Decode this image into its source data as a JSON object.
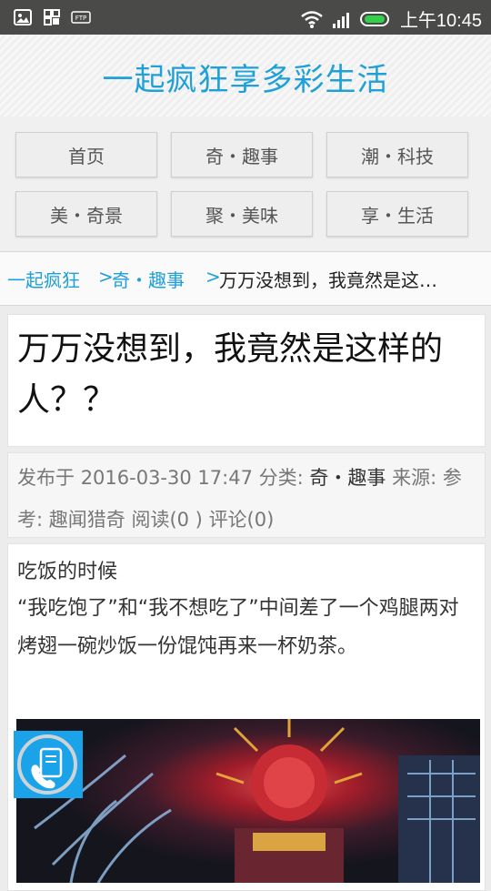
{
  "status_bar": {
    "time": "上午10:45",
    "icons": [
      "image-icon",
      "grid-icon",
      "ftp-icon",
      "wifi-icon",
      "signal-icon",
      "battery-icon"
    ]
  },
  "header": {
    "title": "一起疯狂享多彩生活"
  },
  "nav": {
    "items": [
      {
        "label": "首页"
      },
      {
        "label": "奇・趣事"
      },
      {
        "label": "潮・科技"
      },
      {
        "label": "美・奇景"
      },
      {
        "label": "聚・美味"
      },
      {
        "label": "享・生活"
      }
    ]
  },
  "breadcrumb": {
    "home": "一起疯狂",
    "category": "奇・趣事",
    "current": "万万没想到，我竟然是这…",
    "separator": ">"
  },
  "post": {
    "title": "万万没想到，我竟然是这样的人？？",
    "meta": {
      "published_prefix": "发布于",
      "date": "2016-03-30 17:47",
      "category_prefix": "分类:",
      "category": "奇・趣事",
      "source_prefix": "来源:",
      "source": "参考:",
      "source_name": "趣闻猎奇",
      "reads": "阅读(0 )",
      "comments": "评论(0)"
    },
    "content": {
      "line1": "吃饭的时候",
      "line2": "“我吃饱了”和“我不想吃了”中间差了一个鸡腿两对烤翅一碗炒饭一份馄饨再来一杯奶茶。"
    }
  },
  "colors": {
    "accent": "#1fa0d8",
    "statusbar": "#4a4a48",
    "float_button": "#1aa3e8"
  }
}
